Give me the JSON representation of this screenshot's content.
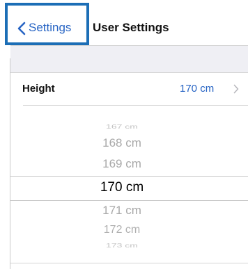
{
  "nav": {
    "back_label": "Settings",
    "title": "User Settings"
  },
  "height_row": {
    "label": "Height",
    "value": "170 cm"
  },
  "picker": {
    "options": [
      "167 cm",
      "168 cm",
      "169 cm",
      "170 cm",
      "171 cm",
      "172 cm",
      "173 cm"
    ],
    "selected": "170 cm"
  },
  "colors": {
    "accent": "#2764c4",
    "highlight_border": "#1c6eb6",
    "group_background": "#efeff4",
    "divider": "#d4d4d4"
  },
  "icons": {
    "back": "chevron-left-icon",
    "disclosure": "chevron-right-icon"
  }
}
